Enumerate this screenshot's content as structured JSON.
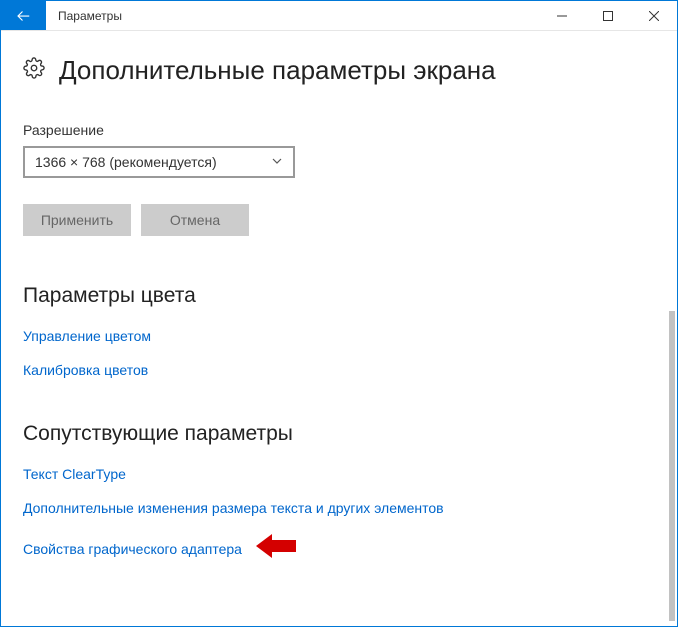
{
  "titlebar": {
    "title": "Параметры"
  },
  "page": {
    "heading": "Дополнительные параметры экрана"
  },
  "resolution": {
    "label": "Разрешение",
    "value": "1366 × 768 (рекомендуется)"
  },
  "buttons": {
    "apply": "Применить",
    "cancel": "Отмена"
  },
  "sections": {
    "color": {
      "heading": "Параметры цвета",
      "links": {
        "color_mgmt": "Управление цветом",
        "color_calib": "Калибровка цветов"
      }
    },
    "related": {
      "heading": "Сопутствующие параметры",
      "links": {
        "cleartype": "Текст ClearType",
        "text_scaling": "Дополнительные изменения размера текста и других элементов",
        "adapter_props": "Свойства графического адаптера"
      }
    }
  }
}
